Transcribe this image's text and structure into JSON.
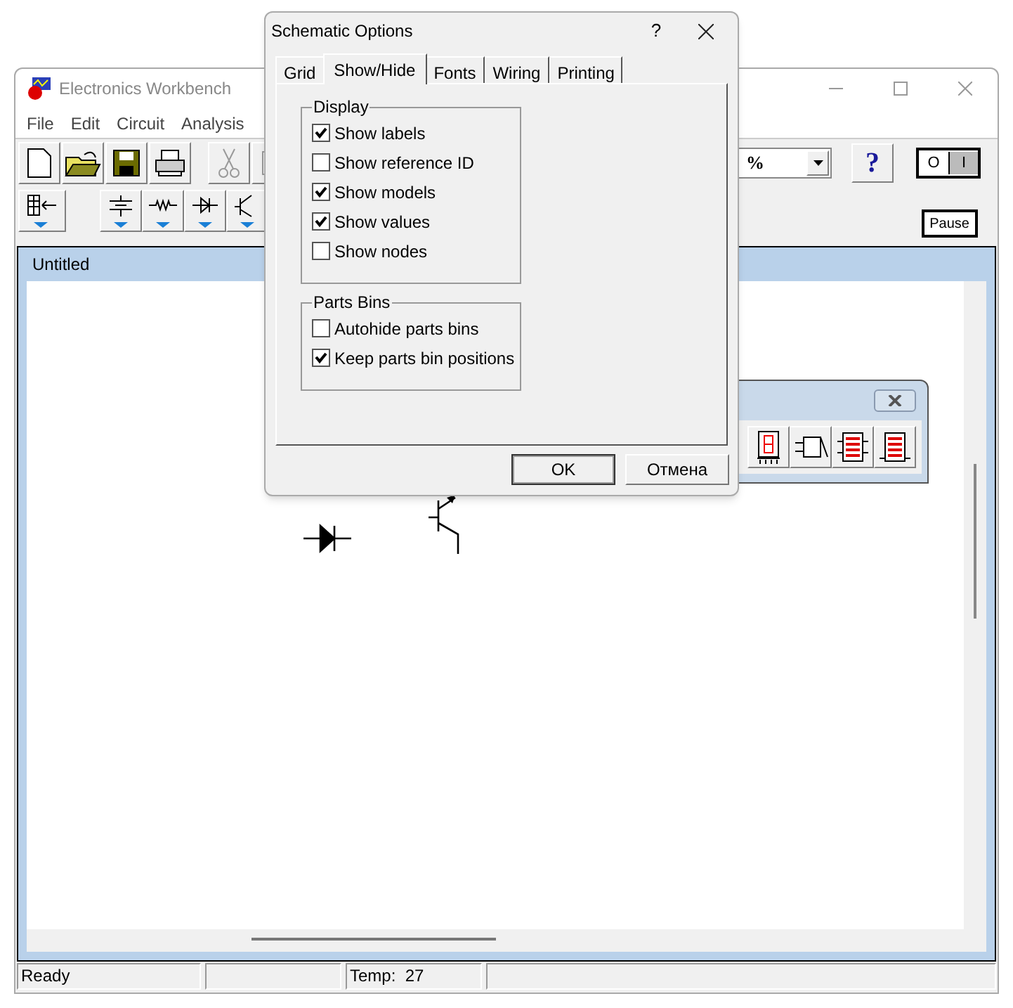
{
  "main_window": {
    "title": "Electronics Workbench",
    "menu": [
      "File",
      "Edit",
      "Circuit",
      "Analysis"
    ],
    "zoom": "%",
    "help_button": "?",
    "power_switch": {
      "off_label": "O",
      "on_label": "I",
      "on": true
    },
    "pause_button": "Pause"
  },
  "circuit_window": {
    "title": "Untitled"
  },
  "status_bar": {
    "pane_1": "Ready",
    "pane_3": "Temp:  27"
  },
  "dialog": {
    "title": "Schematic Options",
    "help": "?",
    "tabs": [
      {
        "label": "Grid",
        "selected": false
      },
      {
        "label": "Show/Hide",
        "selected": true
      },
      {
        "label": "Fonts",
        "selected": false
      },
      {
        "label": "Wiring",
        "selected": false
      },
      {
        "label": "Printing",
        "selected": false
      }
    ],
    "groups": [
      {
        "title": "Display",
        "options": [
          {
            "label": "Show labels",
            "checked": true
          },
          {
            "label": "Show reference ID",
            "checked": false
          },
          {
            "label": "Show models",
            "checked": true
          },
          {
            "label": "Show values",
            "checked": true
          },
          {
            "label": "Show nodes",
            "checked": false
          }
        ]
      },
      {
        "title": "Parts Bins",
        "options": [
          {
            "label": "Autohide parts bins",
            "checked": false
          },
          {
            "label": "Keep parts bin positions",
            "checked": true
          }
        ]
      }
    ],
    "buttons": [
      {
        "label": "OK",
        "default": true
      },
      {
        "label": "Отмена",
        "default": false
      }
    ]
  }
}
